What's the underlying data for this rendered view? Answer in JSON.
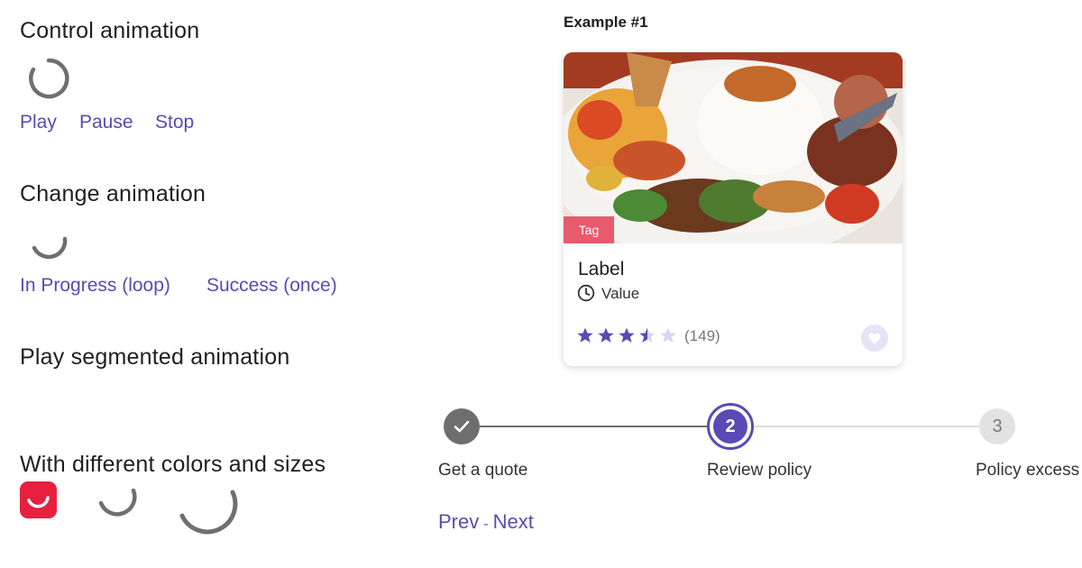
{
  "sections": {
    "control": {
      "title": "Control animation",
      "play": "Play",
      "pause": "Pause",
      "stop": "Stop"
    },
    "change": {
      "title": "Change animation",
      "in_progress": "In Progress (loop)",
      "success": "Success (once)"
    },
    "segmented": {
      "title": "Play segmented animation"
    },
    "colors_sizes": {
      "title": "With different colors and sizes"
    }
  },
  "example": {
    "title": "Example #1",
    "card": {
      "tag": "Tag",
      "label": "Label",
      "value": "Value",
      "rating": 3.5,
      "max_rating": 5,
      "reviews": "(149)",
      "image_alt": "nasi campur food plate"
    }
  },
  "stepper": {
    "steps": [
      {
        "label": "Get a quote",
        "state": "done",
        "number": "1"
      },
      {
        "label": "Review policy",
        "state": "active",
        "number": "2"
      },
      {
        "label": "Policy excess",
        "state": "pending",
        "number": "3"
      }
    ],
    "prev": "Prev",
    "separator": "-",
    "next": "Next"
  },
  "colors": {
    "accent": "#5a4ab5",
    "tag": "#e85a6e",
    "spinner_gray": "#6f6f6f",
    "brand_red": "#e8203f",
    "star_filled": "#5a4ab5",
    "star_empty": "#d9d4f1"
  },
  "icons": [
    "spinner-icon",
    "clock-icon",
    "star-icon",
    "heart-icon",
    "check-icon"
  ]
}
